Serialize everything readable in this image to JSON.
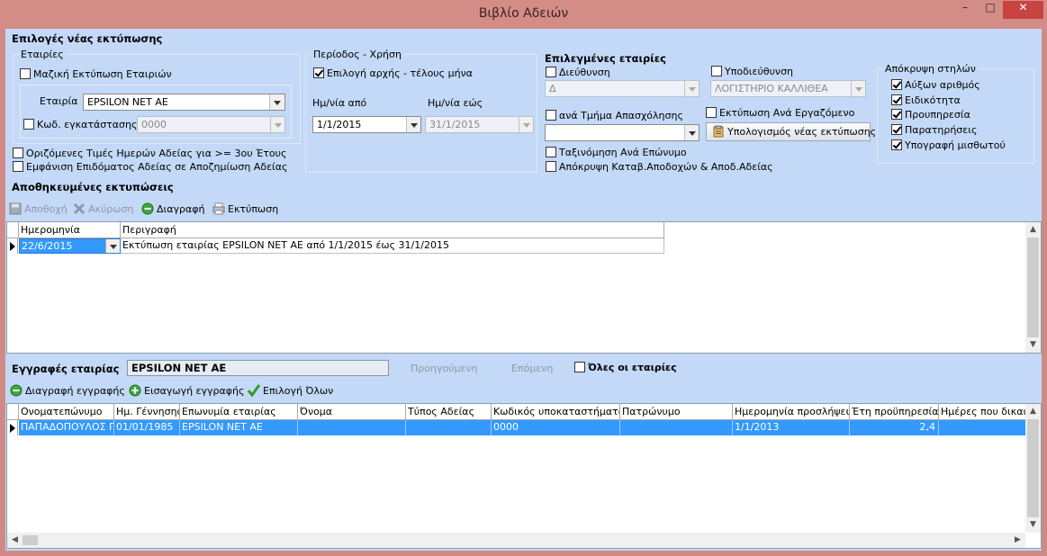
{
  "window": {
    "title": "Βιβλίο Αδειών",
    "minimize_glyph": "–",
    "maximize_glyph": "□",
    "close_glyph": "✕"
  },
  "new_print": {
    "title": "Επιλογές νέας εκτύπωσης",
    "companies_group": "Εταιρίες",
    "mass_print_label": "Μαζική Εκτύπωση Εταιριών",
    "company_label": "Εταιρία",
    "company_value": "EPSILON NET AE",
    "installation_label": "Κωδ. εγκατάστασης",
    "installation_value": "0000",
    "fixed_days_label": "Οριζόμενες Τιμές Ημερών Αδείας  για >= 3ου Έτους",
    "show_allowance_label": "Εμφάνιση Επιδόματος Αδείας σε Αποζημίωση Αδείας"
  },
  "period": {
    "group": "Περίοδος - Χρήση",
    "select_month_label": "Επιλογή αρχής - τέλους μήνα",
    "from_label": "Ημ/νία από",
    "from_value": "1/1/2015",
    "to_label": "Ημ/νία εώς",
    "to_value": "31/1/2015"
  },
  "selected_companies": {
    "title": "Επιλεγμένες εταιρίες",
    "address_label": "Διεύθυνση",
    "address_value": "Δ",
    "subaddress_label": "Υποδιεύθυνση",
    "subaddress_value": "ΛΟΓΙΣΤΗΡΙΟ ΚΑΛΛΙΘΕΑ",
    "department_label": "ανά Τμήμα Απασχόλησης",
    "department_value": "",
    "per_employee_label": "Εκτύπωση Ανά Εργαζόμενο",
    "calculate_button": "Υπολογισμός νέας εκτύπωσης",
    "sort_label": "Ταξινόμηση Ανά Επώνυμο",
    "hide_label": "Απόκρυψη Καταβ.Αποδοχών & Αποδ.Αδείας"
  },
  "hide_columns": {
    "group": "Απόκρυψη στηλών",
    "items": [
      "Αύξων αριθμός",
      "Ειδικότητα",
      "Προυπηρεσία",
      "Παρατηρήσεις",
      "Υπογραφή μισθωτού"
    ]
  },
  "saved_prints": {
    "title": "Αποθηκευμένες εκτυπώσεις",
    "toolbar": {
      "save": "Αποθοχή",
      "cancel": "Ακύρωση",
      "delete": "Διαγραφή",
      "print": "Εκτύπωση"
    },
    "columns": [
      "Ημερομηνία",
      "Περιγραφή"
    ],
    "rows": [
      {
        "date": "22/6/2015",
        "description": "Εκτύπωση εταιρίας EPSILON NET AE από 1/1/2015 έως 31/1/2015"
      }
    ]
  },
  "records": {
    "title": "Εγγραφές εταιρίας",
    "company_value": "EPSILON NET AE",
    "previous_label": "Προηγούμενη",
    "next_label": "Επόμενη",
    "all_companies_label": "Όλες οι εταιρίες",
    "toolbar": {
      "delete": "Διαγραφή εγγραφής",
      "insert": "Εισαγωγή εγγραφής",
      "select_all": "Επιλογή Όλων"
    },
    "columns": [
      "Ονοματεπώνυμο",
      "Ημ. Γέννησης",
      "Επωνυμία εταιρίας",
      "Όνομα",
      "Τύπος Αδείας",
      "Κωδικός υποκαταστήματος",
      "Πατρώνυμο",
      "Ημερομηνία προσλήψεως",
      "Έτη προϋπηρεσίας",
      "Ημέρες που δικαιο"
    ],
    "rows": [
      [
        "ΠΑΠΑΔΟΠΟΥΛΟΣ ΠΑ",
        "01/01/1985",
        "EPSILON NET AE",
        "",
        "",
        "0000",
        "",
        "1/1/2013",
        "2,4",
        ""
      ]
    ]
  },
  "colors": {
    "accent": "#3399ff",
    "panel": "#c3d9f7",
    "frame": "#d48c87"
  }
}
